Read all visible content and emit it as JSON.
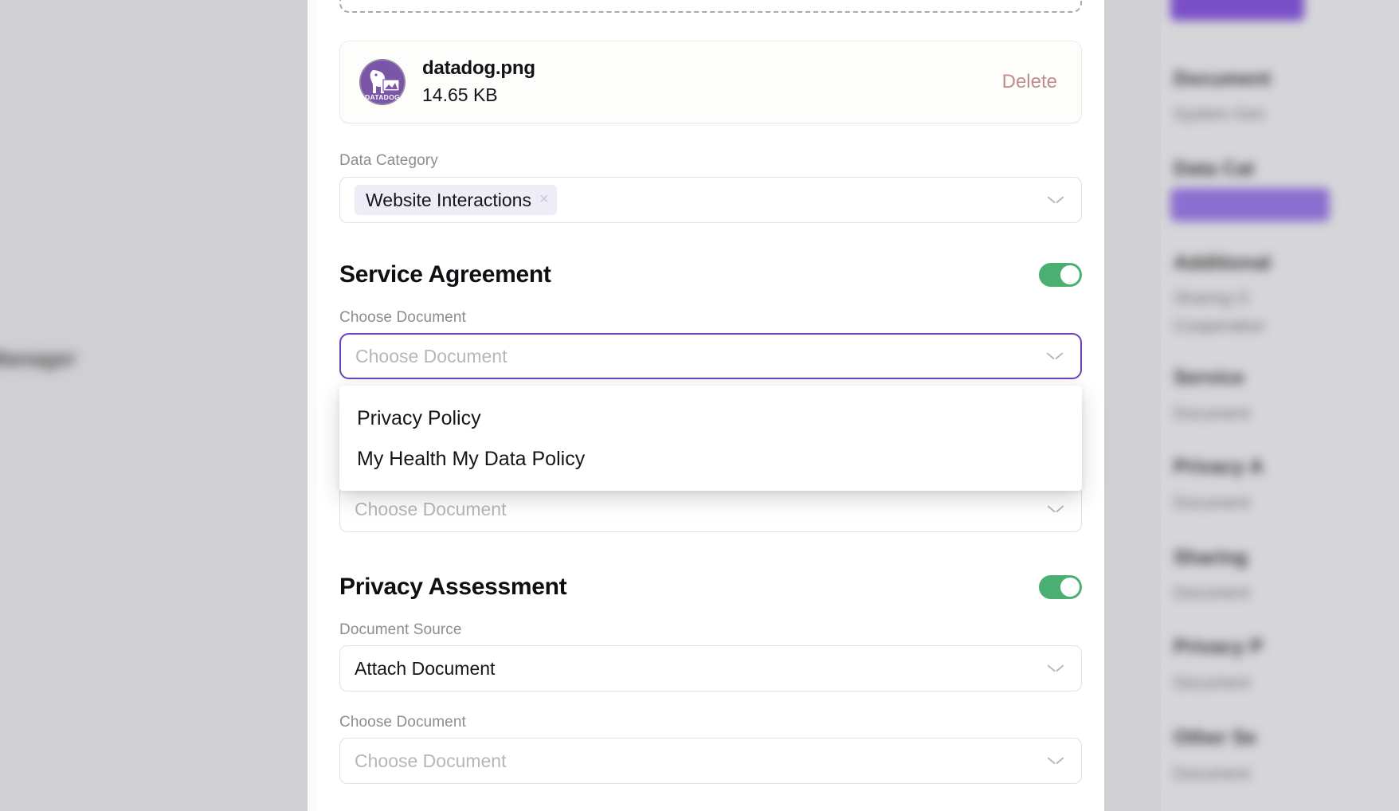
{
  "modal": {
    "file": {
      "name": "datadog.png",
      "size": "14.65 KB",
      "delete_label": "Delete",
      "logo_icon": "datadog-logo-icon"
    },
    "data_category": {
      "label": "Data Category",
      "chips": [
        {
          "text": "Website Interactions",
          "remove_icon": "×"
        }
      ],
      "chevron_icon": "chevron-down-icon"
    },
    "sections": [
      {
        "title": "Service Agreement",
        "toggle_on": true,
        "fields": [
          {
            "label": "Choose Document",
            "placeholder": "Choose Document",
            "value": "",
            "focused": true
          },
          {
            "label": "Choose Document",
            "placeholder": "Choose Document",
            "value": "",
            "focused": false
          }
        ]
      },
      {
        "title": "Privacy Assessment",
        "toggle_on": true,
        "fields": [
          {
            "label": "Document Source",
            "placeholder": "",
            "value": "Attach Document",
            "focused": false
          },
          {
            "label": "Choose Document",
            "placeholder": "Choose Document",
            "value": "",
            "focused": false
          }
        ]
      }
    ],
    "dropdown": {
      "open": true,
      "options": [
        "Privacy Policy",
        "My Health My Data Policy"
      ]
    }
  },
  "backdrop": {
    "left_blurred_text": "a Manager",
    "right_items": [
      {
        "title": "Document",
        "sub": "System Gen"
      },
      {
        "title": "Data Cat",
        "chip": true
      },
      {
        "title": "Additional",
        "sub": "Sharing O",
        "sub2": "Cooperation"
      },
      {
        "title": "Service",
        "sub": "Document"
      },
      {
        "title": "Privacy A",
        "sub": "Document"
      },
      {
        "title": "Sharing",
        "sub": "Document"
      },
      {
        "title": "Privacy P",
        "sub": "Document"
      },
      {
        "title": "Other Se",
        "sub": "Document"
      }
    ]
  },
  "colors": {
    "accent_purple": "#6b43b8",
    "chip_bg": "#efecf8",
    "toggle_green": "#4caf72",
    "delete_red": "#c08c8c",
    "datadog_purple": "#7b55a8",
    "backdrop_gray": "#d0d0d3"
  }
}
